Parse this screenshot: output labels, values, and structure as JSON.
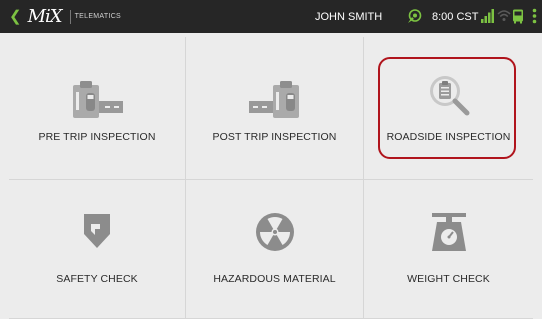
{
  "topbar": {
    "back_icon": "chevron-left-icon",
    "logo": "MiX",
    "brand": "TELEMATICS",
    "user_name": "JOHN SMITH",
    "time": "8:00 CST",
    "accent_color": "#7cc242",
    "icons": [
      "driver-status-icon",
      "signal-icon",
      "wifi-icon",
      "bus-icon",
      "more-vertical-icon"
    ]
  },
  "tiles": [
    {
      "label": "PRE TRIP INSPECTION",
      "icon": "pre-trip-clipboard-icon"
    },
    {
      "label": "POST TRIP INSPECTION",
      "icon": "post-trip-clipboard-icon"
    },
    {
      "label": "ROADSIDE INSPECTION",
      "icon": "search-clipboard-icon",
      "highlight_color": "#b0141c"
    },
    {
      "label": "SAFETY CHECK",
      "icon": "shield-icon"
    },
    {
      "label": "HAZARDOUS MATERIAL",
      "icon": "radiation-icon"
    },
    {
      "label": "WEIGHT CHECK",
      "icon": "scale-icon"
    }
  ]
}
